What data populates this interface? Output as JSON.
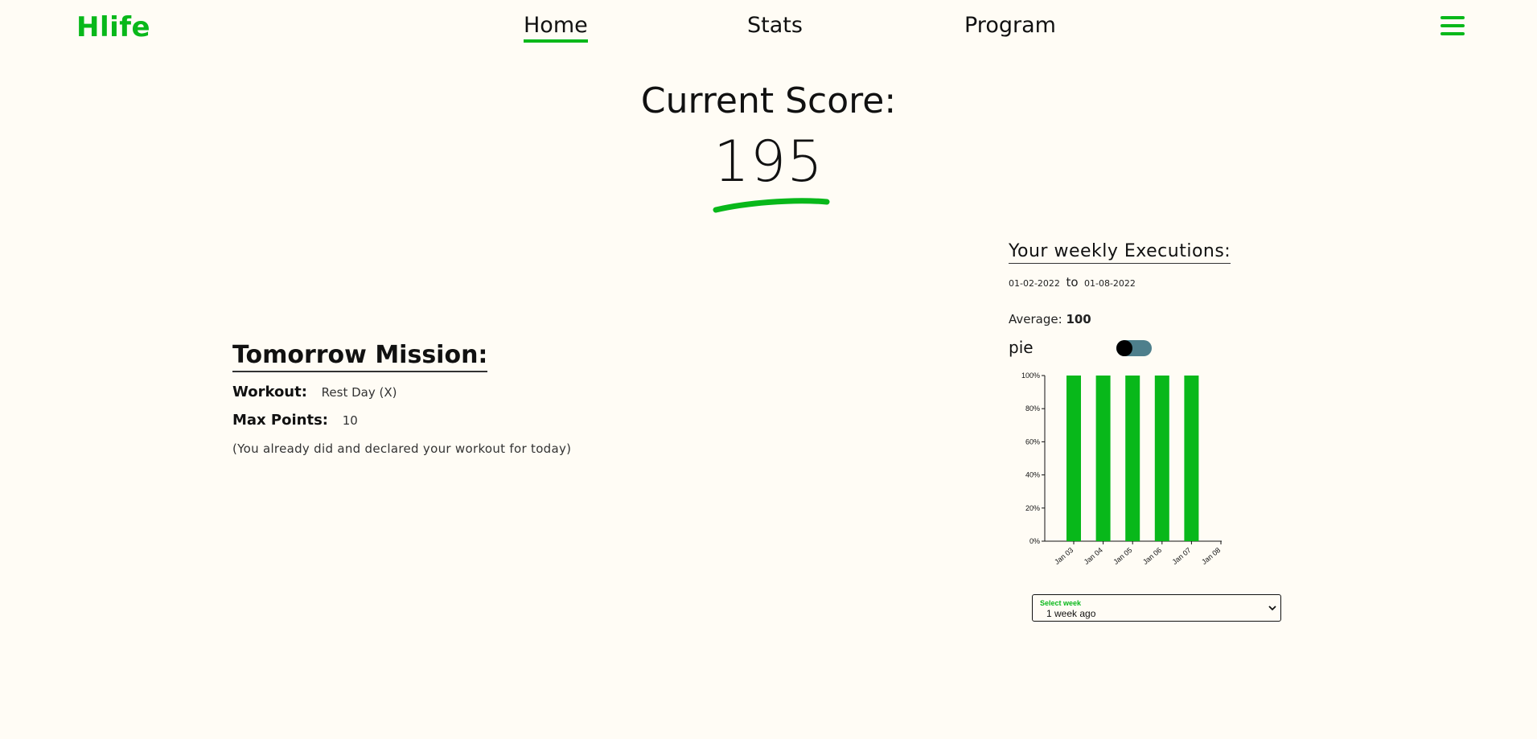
{
  "header": {
    "logo": "Hlife",
    "nav": [
      "Home",
      "Stats",
      "Program"
    ],
    "active_nav": "Home",
    "menu_icon": "hamburger-icon"
  },
  "score": {
    "title": "Current Score:",
    "value": "195"
  },
  "mission": {
    "title": "Tomorrow Mission:",
    "workout_label": "Workout:",
    "workout_value": "Rest Day (X)",
    "points_label": "Max Points:",
    "points_value": "10",
    "note": "(You already did and declared your workout for today)"
  },
  "weekly": {
    "title": "Your weekly Executions:",
    "date_from": "01-02-2022",
    "date_to_word": "to",
    "date_to": "01-08-2022",
    "average_label": "Average:",
    "average_value": "100",
    "toggle_label": "pie",
    "toggle_on": false
  },
  "week_select": {
    "label": "Select week",
    "value": "1 week ago"
  },
  "colors": {
    "accent": "#08b81a",
    "background": "#fffcf5",
    "toggle_track": "#4e7f8c"
  },
  "chart_data": {
    "type": "bar",
    "categories": [
      "Jan 03",
      "Jan 04",
      "Jan 05",
      "Jan 06",
      "Jan 07"
    ],
    "values": [
      100,
      100,
      100,
      100,
      100
    ],
    "x_ticks": [
      "Jan 03",
      "Jan 04",
      "Jan 05",
      "Jan 06",
      "Jan 07",
      "Jan 08"
    ],
    "y_ticks": [
      "0%",
      "20%",
      "40%",
      "60%",
      "80%",
      "100%"
    ],
    "ylim": [
      0,
      100
    ],
    "grid": false,
    "color": "#08b81a"
  }
}
